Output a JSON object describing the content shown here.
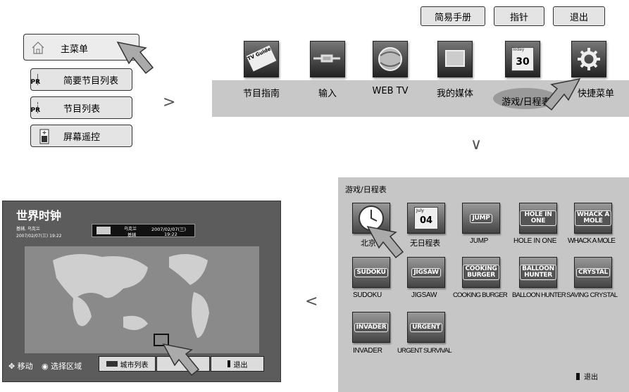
{
  "menu": {
    "items": [
      {
        "label": "主菜单",
        "icon": "home-icon"
      },
      {
        "label": "简要节目列表",
        "icon": "pr-icon"
      },
      {
        "label": "节目列表",
        "icon": "pr-list-icon"
      },
      {
        "label": "屏幕遥控",
        "icon": "remote-icon"
      }
    ],
    "pr_text": "PR"
  },
  "top_buttons": {
    "guide": "简易手册",
    "pointer": "指针",
    "exit": "退出"
  },
  "arrows": {
    "right": ">",
    "down": "∨",
    "left": "<"
  },
  "icon_bar": {
    "items": [
      {
        "label": "节目指南",
        "badge": "TV Guide"
      },
      {
        "label": "输入"
      },
      {
        "label": "WEB TV"
      },
      {
        "label": "我的媒体"
      },
      {
        "label": "游戏/日程表",
        "badge": "30",
        "badge_top": "Today"
      },
      {
        "label": "快捷菜单"
      }
    ]
  },
  "games": {
    "title": "游戏/日程表",
    "row1": [
      {
        "label": "北京",
        "logo": ""
      },
      {
        "label": "无日程表",
        "logo": "04",
        "logo_top": "July"
      },
      {
        "label": "JUMP",
        "logo": "JUMP"
      },
      {
        "label": "HOLE IN ONE",
        "logo": "HOLE IN ONE"
      },
      {
        "label": "WHACK A MOLE",
        "logo": "WHACK A MOLE"
      }
    ],
    "row2": [
      {
        "label": "SUDOKU",
        "logo": "SUDOKU"
      },
      {
        "label": "JIGSAW",
        "logo": "JIGSAW"
      },
      {
        "label": "COOKING BURGER",
        "logo": "COOKING BURGER"
      },
      {
        "label": "BALLOON HUNTER",
        "logo": "BALLOON HUNTER"
      },
      {
        "label": "SAVING CRYSTAL",
        "logo": "CRYSTAL"
      }
    ],
    "row3": [
      {
        "label": "INVADER",
        "logo": "INVADER"
      },
      {
        "label": "URGENT SURVIVAL",
        "logo": "URGENT"
      }
    ],
    "exit_label": "退出"
  },
  "world_clock": {
    "title": "世界时钟",
    "location": "基辅, 乌克兰",
    "datetime": "2007/02/07(三) 19:22",
    "info_city_a": "乌克兰",
    "info_city_b": "基辅",
    "info_date": "2007/02/07(三)",
    "info_time": "19:22",
    "move_label": "移动",
    "select_label": "选择区域",
    "city_list_btn": "城市列表",
    "exit_btn": "退出"
  }
}
